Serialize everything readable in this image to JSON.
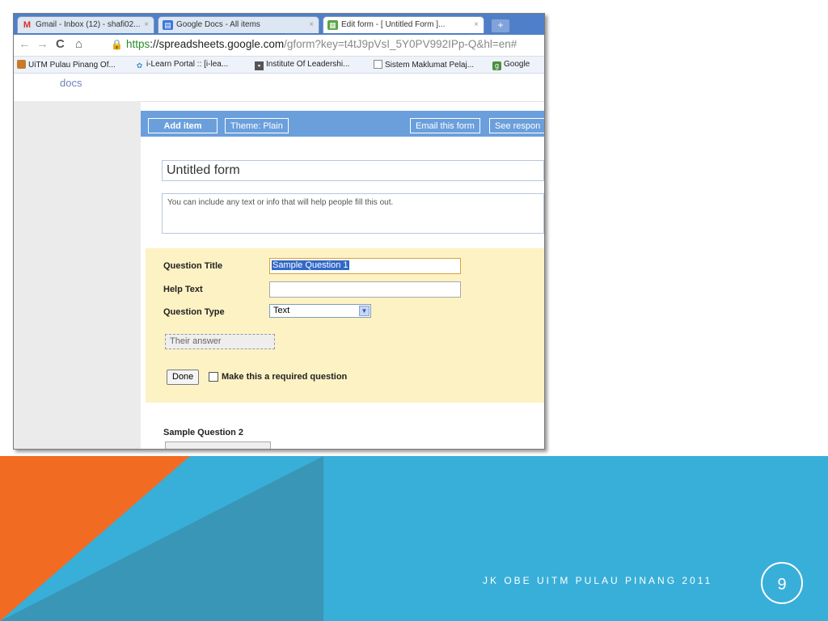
{
  "browser": {
    "tabs": [
      {
        "label": "Gmail - Inbox (12) - shafi02...",
        "icon": "gmail-icon"
      },
      {
        "label": "Google Docs - All items",
        "icon": "docs-icon"
      },
      {
        "label": "Edit form - [ Untitled Form ]...",
        "icon": "form-icon"
      }
    ],
    "tab_close": "×",
    "new_tab": "+",
    "url_https": "https",
    "url_host": "://spreadsheets.google.com",
    "url_rest": "/gform?key=t4tJ9pVsI_5Y0PV992IPp-Q&hl=en#",
    "bookmarks": [
      "UiTM Pulau Pinang Of...",
      "i-Learn Portal :: [i-lea...",
      "Institute Of Leadershi...",
      "Sistem Maklumat Pelaj...",
      "Google"
    ]
  },
  "docs": {
    "logo": "docs"
  },
  "editor": {
    "add_item": "Add item",
    "theme": "Theme:  Plain",
    "email_form": "Email this form",
    "see_responses": "See respon"
  },
  "form": {
    "title": "Untitled form",
    "description": "You can include any text or info that will help people fill this out.",
    "question": {
      "title_label": "Question Title",
      "title_value": "Sample Question 1",
      "help_label": "Help Text",
      "help_value": "",
      "type_label": "Question Type",
      "type_value": "Text",
      "answer_placeholder": "Their answer",
      "done": "Done",
      "required_label": "Make this a required question"
    },
    "question2": {
      "title": "Sample Question 2"
    }
  },
  "slide": {
    "footer": "JK OBE UITM PULAU PINANG 2011",
    "page": "9"
  },
  "colors": {
    "band": "#38afd9",
    "orange": "#f26b22",
    "dark_band": "#3a96b6",
    "editbar": "#6a9fdc",
    "question_panel": "#fdf2c4"
  }
}
